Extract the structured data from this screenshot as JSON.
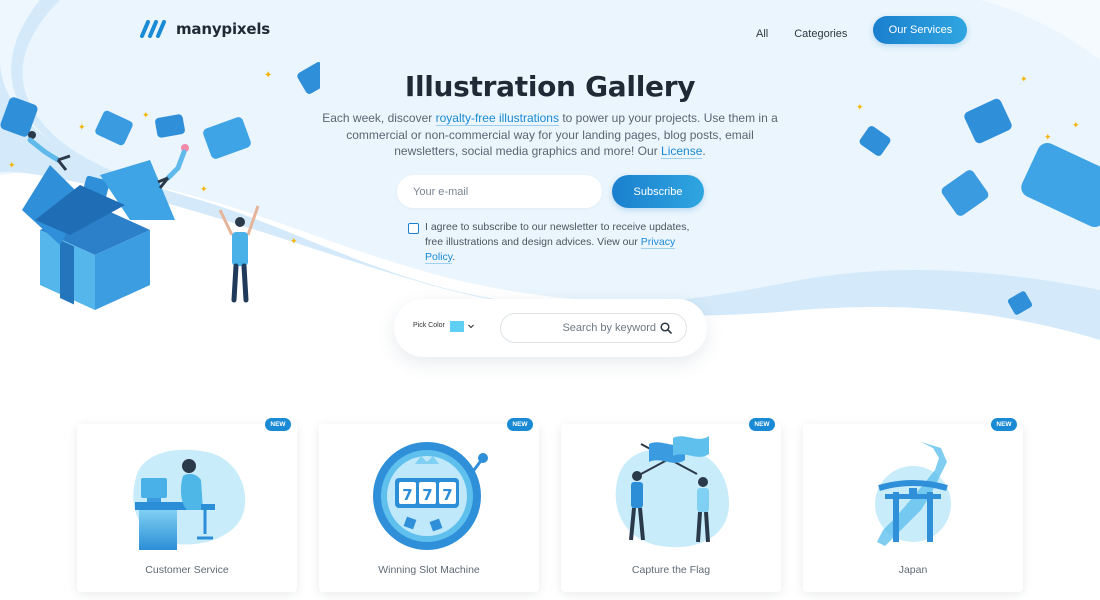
{
  "header": {
    "logo_text": "manypixels",
    "nav": [
      {
        "label": "All"
      },
      {
        "label": "Categories"
      }
    ],
    "services_label": "Our Services"
  },
  "hero": {
    "title": "Illustration Gallery",
    "desc_part1": "Each week, discover ",
    "desc_link1": "royalty-free illustrations",
    "desc_part2": " to power up your projects. Use them in a commercial or non-commercial way for your landing pages, blog posts, email newsletters, social media graphics and more! Our ",
    "desc_link2": "License",
    "desc_part3": "."
  },
  "subscribe": {
    "email_placeholder": "Your e-mail",
    "button_label": "Subscribe",
    "agree_text": "I agree to subscribe to our newsletter to receive updates, free illustrations and design advices. View our ",
    "privacy_link": "Privacy Policy",
    "agree_end": "."
  },
  "search": {
    "pick_color_label": "Pick Color",
    "selected_color": "#5fd0f4",
    "placeholder": "Search by keyword",
    "icon": "search-icon"
  },
  "cards": [
    {
      "badge": "NEW",
      "title": "Customer Service"
    },
    {
      "badge": "NEW",
      "title": "Winning Slot Machine"
    },
    {
      "badge": "NEW",
      "title": "Capture the Flag"
    },
    {
      "badge": "NEW",
      "title": "Japan"
    }
  ],
  "colors": {
    "accent": "#1a8ad4",
    "accent_light": "#5fd0f4",
    "hero_bg": "#e8f4fc"
  }
}
